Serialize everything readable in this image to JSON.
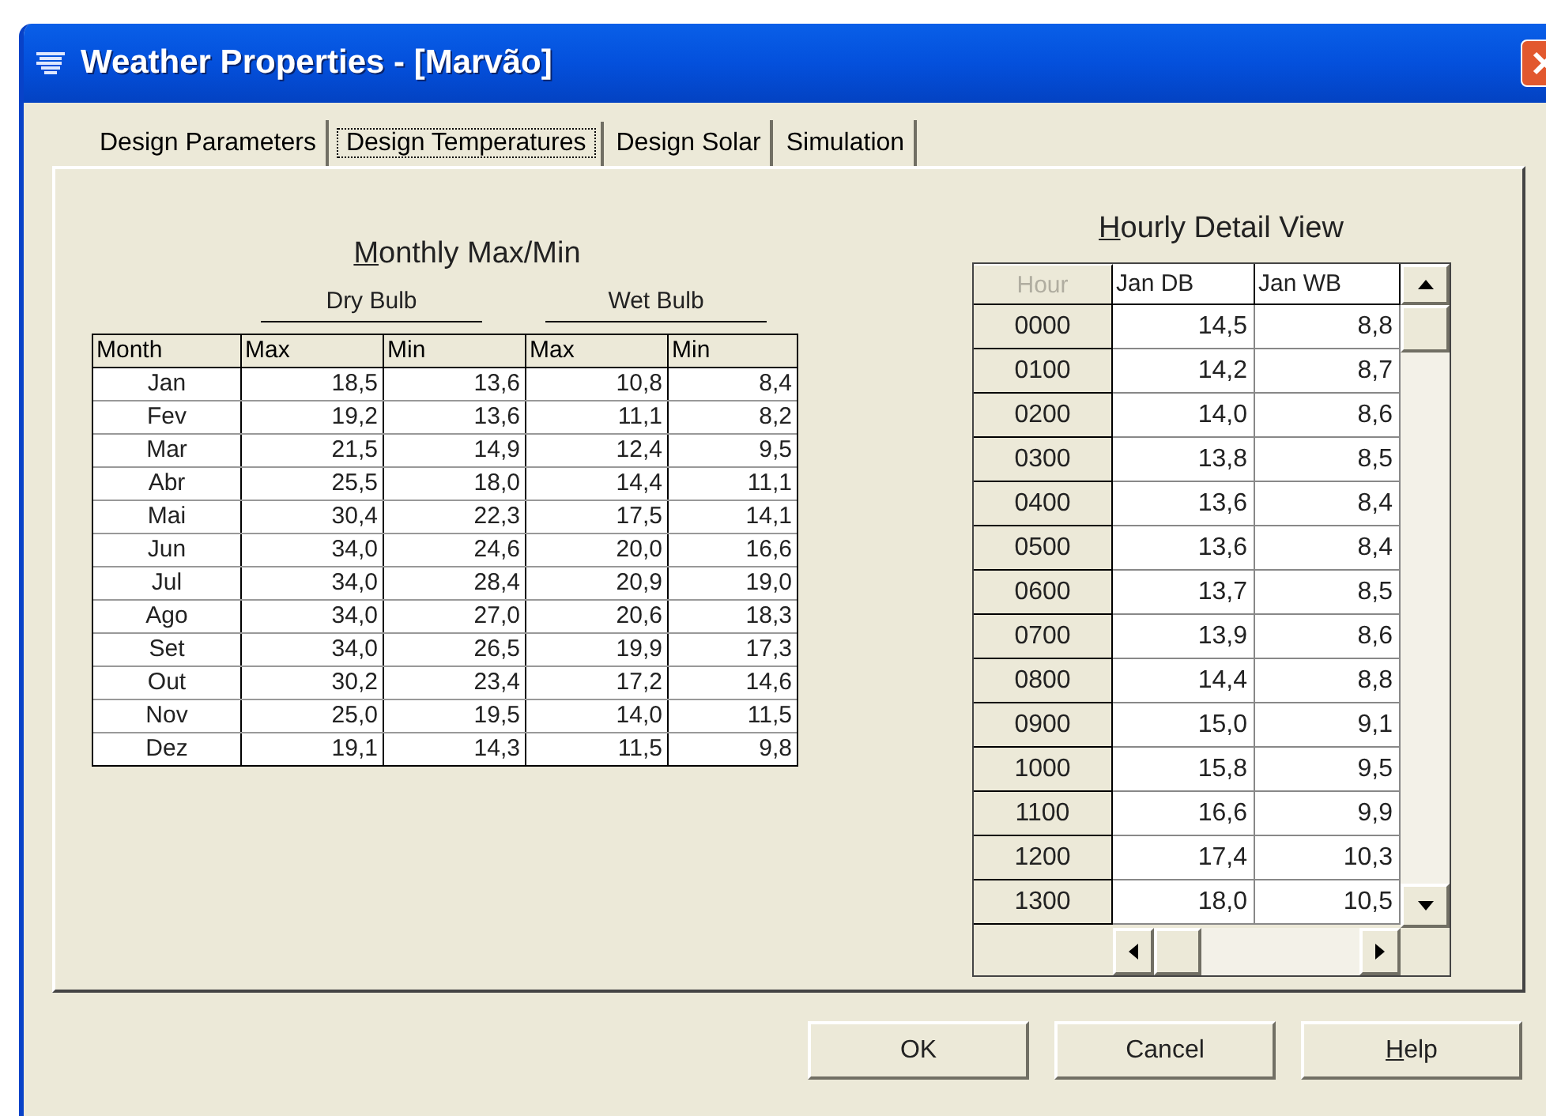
{
  "window": {
    "title": "Weather Properties - [Marvão]"
  },
  "tabs": [
    {
      "label": "Design Parameters",
      "selected": false
    },
    {
      "label": "Design Temperatures",
      "selected": true
    },
    {
      "label": "Design Solar",
      "selected": false
    },
    {
      "label": "Simulation",
      "selected": false
    }
  ],
  "monthly": {
    "title": "Monthly Max/Min",
    "mnemonic": true,
    "groups": [
      "Dry Bulb",
      "Wet Bulb"
    ],
    "columns": [
      "Month",
      "Max",
      "Min",
      "Max",
      "Min"
    ],
    "rows": [
      [
        "Jan",
        "18,5",
        "13,6",
        "10,8",
        "8,4"
      ],
      [
        "Fev",
        "19,2",
        "13,6",
        "11,1",
        "8,2"
      ],
      [
        "Mar",
        "21,5",
        "14,9",
        "12,4",
        "9,5"
      ],
      [
        "Abr",
        "25,5",
        "18,0",
        "14,4",
        "11,1"
      ],
      [
        "Mai",
        "30,4",
        "22,3",
        "17,5",
        "14,1"
      ],
      [
        "Jun",
        "34,0",
        "24,6",
        "20,0",
        "16,6"
      ],
      [
        "Jul",
        "34,0",
        "28,4",
        "20,9",
        "19,0"
      ],
      [
        "Ago",
        "34,0",
        "27,0",
        "20,6",
        "18,3"
      ],
      [
        "Set",
        "34,0",
        "26,5",
        "19,9",
        "17,3"
      ],
      [
        "Out",
        "30,2",
        "23,4",
        "17,2",
        "14,6"
      ],
      [
        "Nov",
        "25,0",
        "19,5",
        "14,0",
        "11,5"
      ],
      [
        "Dez",
        "19,1",
        "14,3",
        "11,5",
        "9,8"
      ]
    ]
  },
  "hourly": {
    "title": "Hourly Detail View",
    "mnemonic": true,
    "columns": [
      {
        "label": "Hour",
        "disabled": true
      },
      {
        "label": "Jan DB",
        "disabled": false
      },
      {
        "label": "Jan WB",
        "disabled": false
      }
    ],
    "rows": [
      [
        "0000",
        "14,5",
        "8,8"
      ],
      [
        "0100",
        "14,2",
        "8,7"
      ],
      [
        "0200",
        "14,0",
        "8,6"
      ],
      [
        "0300",
        "13,8",
        "8,5"
      ],
      [
        "0400",
        "13,6",
        "8,4"
      ],
      [
        "0500",
        "13,6",
        "8,4"
      ],
      [
        "0600",
        "13,7",
        "8,5"
      ],
      [
        "0700",
        "13,9",
        "8,6"
      ],
      [
        "0800",
        "14,4",
        "8,8"
      ],
      [
        "0900",
        "15,0",
        "9,1"
      ],
      [
        "1000",
        "15,8",
        "9,5"
      ],
      [
        "1100",
        "16,6",
        "9,9"
      ],
      [
        "1200",
        "17,4",
        "10,3"
      ],
      [
        "1300",
        "18,0",
        "10,5"
      ]
    ]
  },
  "buttons": [
    {
      "label": "OK"
    },
    {
      "label": "Cancel"
    },
    {
      "label": "Help",
      "mnemonic": true
    }
  ]
}
